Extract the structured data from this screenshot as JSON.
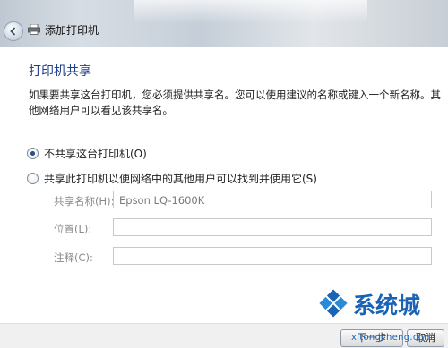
{
  "window": {
    "title": "添加打印机"
  },
  "page": {
    "heading": "打印机共享",
    "description": "如果要共享这台打印机，您必须提供共享名。您可以使用建议的名称或键入一个新名称。其他网络用户可以看见该共享名。"
  },
  "options": {
    "no_share": {
      "label": "不共享这台打印机(O)",
      "selected": true
    },
    "share": {
      "label": "共享此打印机以便网络中的其他用户可以找到并使用它(S)",
      "selected": false
    }
  },
  "fields": {
    "share_name": {
      "label": "共享名称(H):",
      "value": "Epson LQ-1600K"
    },
    "location": {
      "label": "位置(L):",
      "value": ""
    },
    "comment": {
      "label": "注释(C):",
      "value": ""
    }
  },
  "buttons": {
    "next": "下一步",
    "cancel": "取消"
  },
  "watermark": {
    "text": "系统城",
    "url": "xitongcheng.com"
  },
  "colors": {
    "heading": "#1e3f8a",
    "watermark": "#1a63b5"
  }
}
